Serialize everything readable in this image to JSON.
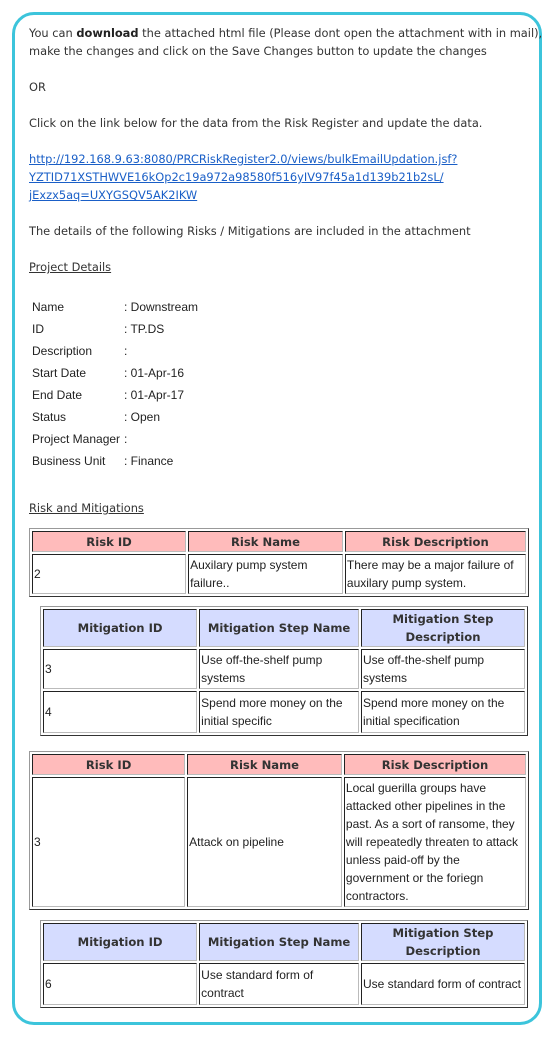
{
  "intro": {
    "line1_pre": "You can ",
    "line1_bold": "download",
    "line1_post": " the attached html file (Please dont open the attachment with in mail),",
    "line2": "make the changes and click on the Save Changes button to update the changes",
    "or": "OR",
    "click_text": "Click on the link below for the data from the Risk Register and update the data.",
    "link_line1": "http://192.168.9.63:8080/PRCRiskRegister2.0/views/bulkEmailUpdation.jsf?",
    "link_line2": "YZTID71XSTHWVE16kOp2c19a972a98580f516yIV97f45a1d139b21b2sL/",
    "link_line3": "jExzx5aq=UXYGSQV5AK2IKW",
    "details_text": "The details of the following Risks / Mitigations are included in the attachment"
  },
  "project": {
    "heading": "Project Details",
    "fields": [
      {
        "label": "Name",
        "value": ": Downstream"
      },
      {
        "label": "ID",
        "value": ": TP.DS"
      },
      {
        "label": "Description",
        "value": ":"
      },
      {
        "label": "Start Date",
        "value": ": 01-Apr-16"
      },
      {
        "label": "End Date",
        "value": ": 01-Apr-17"
      },
      {
        "label": "Status",
        "value": ": Open"
      },
      {
        "label": "Project Manager",
        "value": ":"
      },
      {
        "label": "Business Unit",
        "value": ": Finance"
      }
    ]
  },
  "risks": {
    "heading": "Risk and Mitigations",
    "risk_headers": [
      "Risk ID",
      "Risk Name",
      "Risk Description"
    ],
    "mitigation_headers": [
      "Mitigation ID",
      "Mitigation Step Name",
      "Mitigation Step Description"
    ],
    "items": [
      {
        "id": "2",
        "name": "Auxilary pump system failure..",
        "description": "There may be a major failure of auxilary pump system.",
        "mitigations": [
          {
            "id": "3",
            "name": "Use off-the-shelf pump systems",
            "description": "Use off-the-shelf pump systems"
          },
          {
            "id": "4",
            "name": "Spend more money on the initial specific",
            "description": "Spend more money on the initial specification"
          }
        ]
      },
      {
        "id": "3",
        "name": "Attack on pipeline",
        "description": "Local guerilla groups have attacked other pipelines in the past. As a sort of ransome, they will repeatedly threaten to attack unless paid-off by the government or the foriegn contractors.",
        "mitigations": [
          {
            "id": "6",
            "name": "Use standard form of contract",
            "description": "Use standard form of contract"
          }
        ]
      }
    ]
  },
  "colors": {
    "frame_border": "#3cc4db",
    "risk_header_bg": "#ffbbbb",
    "mitigation_header_bg": "#d5dcff",
    "link": "#1a5fc7"
  }
}
